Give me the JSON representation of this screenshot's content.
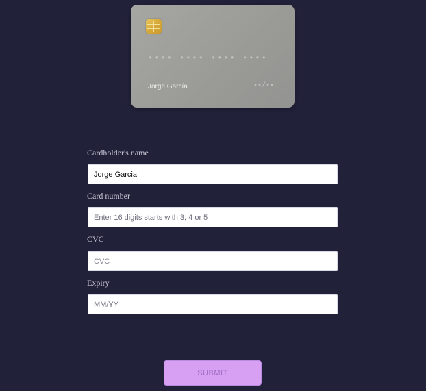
{
  "card": {
    "number": "•••• •••• •••• ••••",
    "holder": "Jorge García",
    "expiry": "••/••"
  },
  "form": {
    "cardholder": {
      "label": "Cardholder's name",
      "value": "Jorge Garcia",
      "placeholder": ""
    },
    "card_number": {
      "label": "Card number",
      "value": "",
      "placeholder": "Enter 16 digits starts with 3, 4 or 5"
    },
    "cvc": {
      "label": "CVC",
      "value": "",
      "placeholder": "CVC"
    },
    "expiry": {
      "label": "Expiry",
      "value": "",
      "placeholder": "MM/YY"
    }
  },
  "submit": {
    "label": "SUBMIT"
  },
  "colors": {
    "background": "#22213a",
    "card": "#a6a6a2",
    "chip": "#d7a93a",
    "button": "#d7a0f2"
  }
}
